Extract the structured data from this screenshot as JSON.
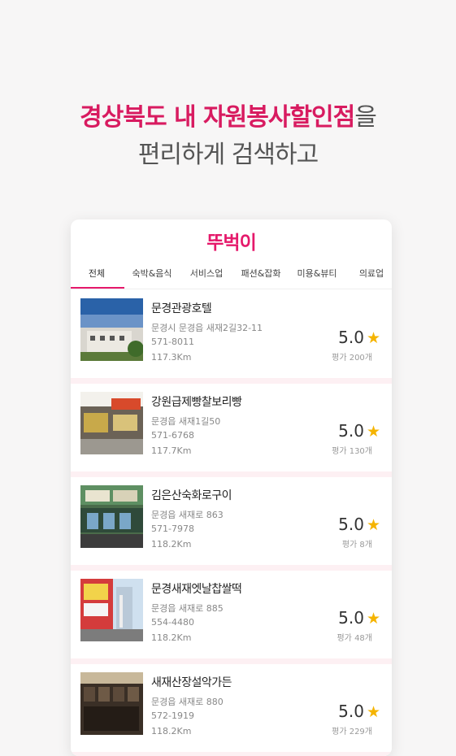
{
  "headline": {
    "highlight": "경상북도 내 자원봉사할인점",
    "suffix": "을"
  },
  "subline": "편리하게 검색하고",
  "app": {
    "logo": "뚜벅이",
    "tabs": [
      {
        "label": "전체",
        "active": true
      },
      {
        "label": "숙박&음식",
        "active": false
      },
      {
        "label": "서비스업",
        "active": false
      },
      {
        "label": "패션&잡화",
        "active": false
      },
      {
        "label": "미용&뷰티",
        "active": false
      },
      {
        "label": "의료업",
        "active": false
      }
    ],
    "accent_color": "#e5196b",
    "star_color": "#f5b400",
    "items": [
      {
        "name": "문경관광호텔",
        "address": "문경시 문경읍 새재2길32-11",
        "phone": "571-8011",
        "distance": "117.3Km",
        "rating": "5.0",
        "reviews": "평가 200개",
        "thumb_icon": "hotel-photo"
      },
      {
        "name": "강원급제빵찰보리빵",
        "address": "문경읍 새재1길50",
        "phone": "571-6768",
        "distance": "117.7Km",
        "rating": "5.0",
        "reviews": "평가 130개",
        "thumb_icon": "bakery-photo"
      },
      {
        "name": "김은산숙화로구이",
        "address": "문경읍 새재로 863",
        "phone": "571-7978",
        "distance": "118.2Km",
        "rating": "5.0",
        "reviews": "평가 8개",
        "thumb_icon": "restaurant-photo"
      },
      {
        "name": "문경새재엣날찹쌀떡",
        "address": "문경읍 새재로 885",
        "phone": "554-4480",
        "distance": "118.2Km",
        "rating": "5.0",
        "reviews": "평가 48개",
        "thumb_icon": "rice-cake-shop-photo"
      },
      {
        "name": "새재산장설악가든",
        "address": "문경읍 새재로 880",
        "phone": "572-1919",
        "distance": "118.2Km",
        "rating": "5.0",
        "reviews": "평가 229개",
        "thumb_icon": "garden-restaurant-photo"
      }
    ]
  }
}
